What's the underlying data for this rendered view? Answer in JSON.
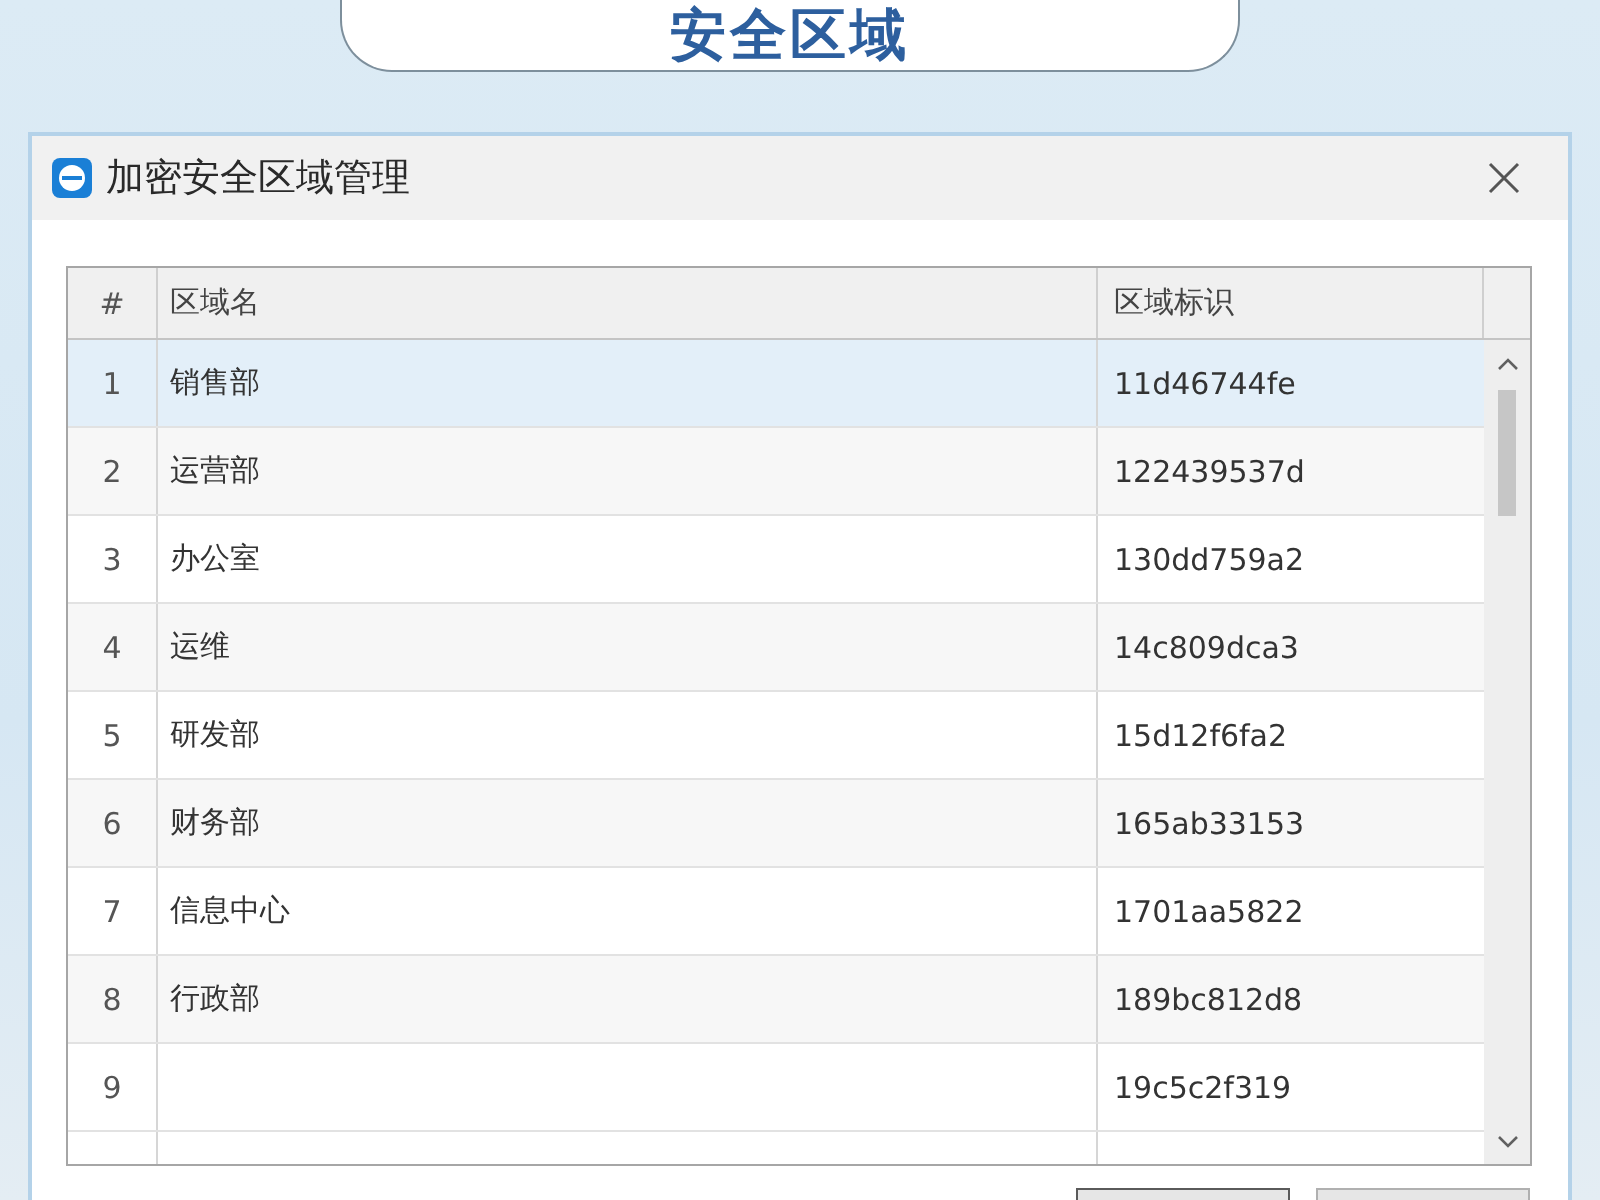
{
  "banner": {
    "title": "安全区域"
  },
  "window": {
    "title": "加密安全区域管理"
  },
  "table": {
    "columns": [
      "#",
      "区域名",
      "区域标识"
    ],
    "rows": [
      {
        "number": "1",
        "name": "销售部",
        "identifier": "11d46744fe",
        "selected": true
      },
      {
        "number": "2",
        "name": "运营部",
        "identifier": "122439537d",
        "selected": false
      },
      {
        "number": "3",
        "name": "办公室",
        "identifier": "130dd759a2",
        "selected": false
      },
      {
        "number": "4",
        "name": "运维",
        "identifier": "14c809dca3",
        "selected": false
      },
      {
        "number": "5",
        "name": "研发部",
        "identifier": "15d12f6fa2",
        "selected": false
      },
      {
        "number": "6",
        "name": "财务部",
        "identifier": "165ab33153",
        "selected": false
      },
      {
        "number": "7",
        "name": "信息中心",
        "identifier": "1701aa5822",
        "selected": false
      },
      {
        "number": "8",
        "name": "行政部",
        "identifier": "189bc812d8",
        "selected": false
      },
      {
        "number": "9",
        "identifier": "19c5c2f319",
        "selected": false
      }
    ]
  }
}
